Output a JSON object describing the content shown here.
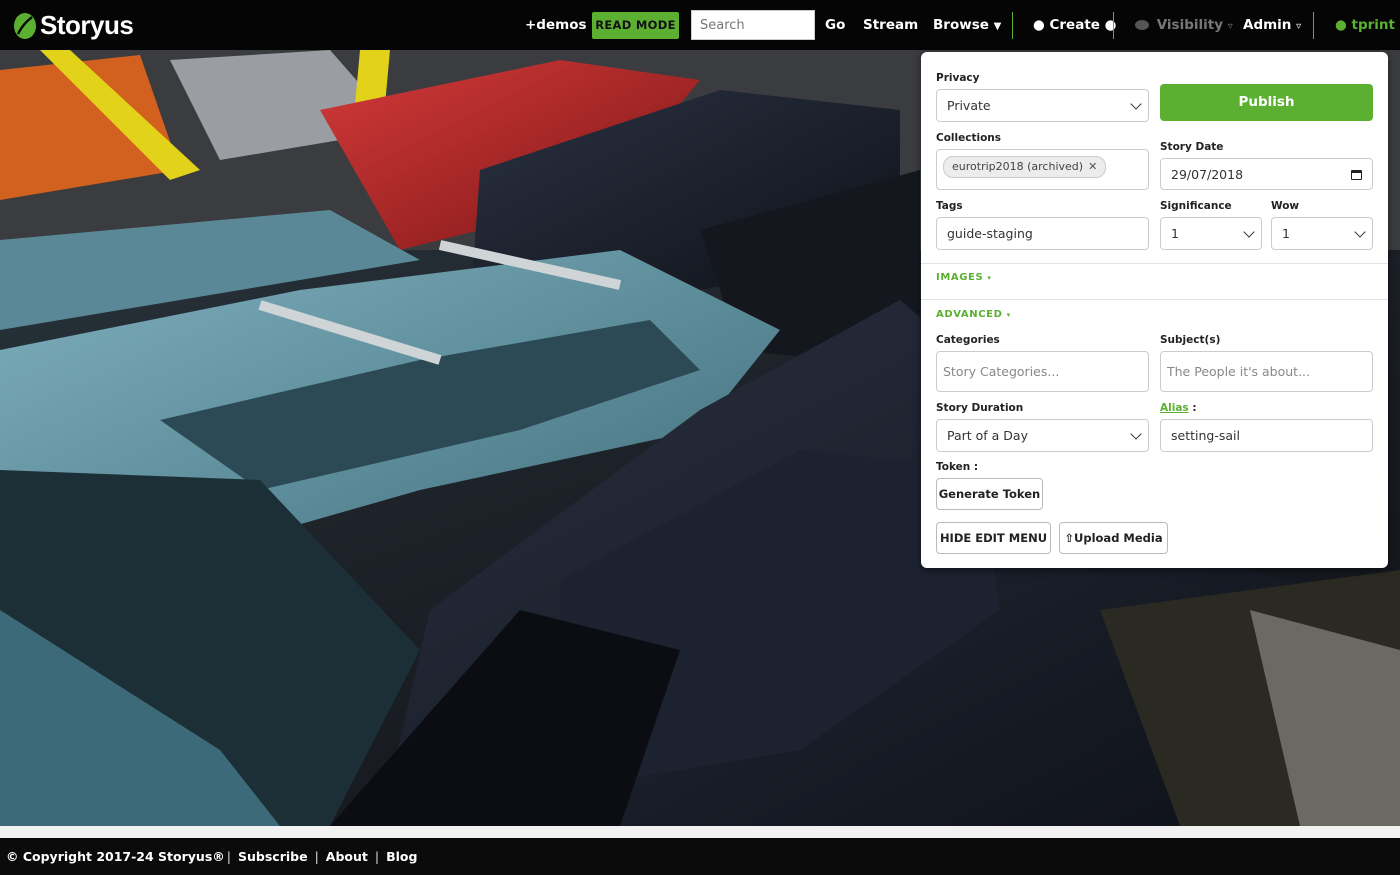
{
  "nav": {
    "logo_text": "Storyus",
    "demos": "+demos",
    "read_mode": "READ MODE",
    "search_placeholder": "Search",
    "go": "Go",
    "stream": "Stream",
    "browse": "Browse",
    "create": "Create",
    "visibility": "Visibility",
    "admin": "Admin",
    "user": "tprint"
  },
  "panel": {
    "privacy_label": "Privacy",
    "privacy_value": "Private",
    "publish": "Publish",
    "collections_label": "Collections",
    "collection_chip": "eurotrip2018 (archived)",
    "story_date_label": "Story Date",
    "story_date_value": "29/07/2018",
    "tags_label": "Tags",
    "tags_value": "guide-staging",
    "significance_label": "Significance",
    "significance_value": "1",
    "wow_label": "Wow",
    "wow_value": "1",
    "images_link": "IMAGES",
    "advanced_link": "ADVANCED",
    "categories_label": "Categories",
    "categories_placeholder": "Story Categories...",
    "subjects_label": "Subject(s)",
    "subjects_placeholder": "The People it's about...",
    "duration_label": "Story Duration",
    "duration_value": "Part of a Day",
    "alias_label": "Alias",
    "alias_value": "setting-sail",
    "token_label": "Token :",
    "generate_token": "Generate Token",
    "hide_edit_menu": "HIDE EDIT MENU",
    "upload_media": "Upload Media"
  },
  "footer": {
    "copyright": "© Copyright 2017-24 Storyus®",
    "subscribe": "Subscribe",
    "about": "About",
    "blog": "Blog"
  },
  "colors": {
    "accent": "#5cb031",
    "nav_bg": "#050505"
  }
}
